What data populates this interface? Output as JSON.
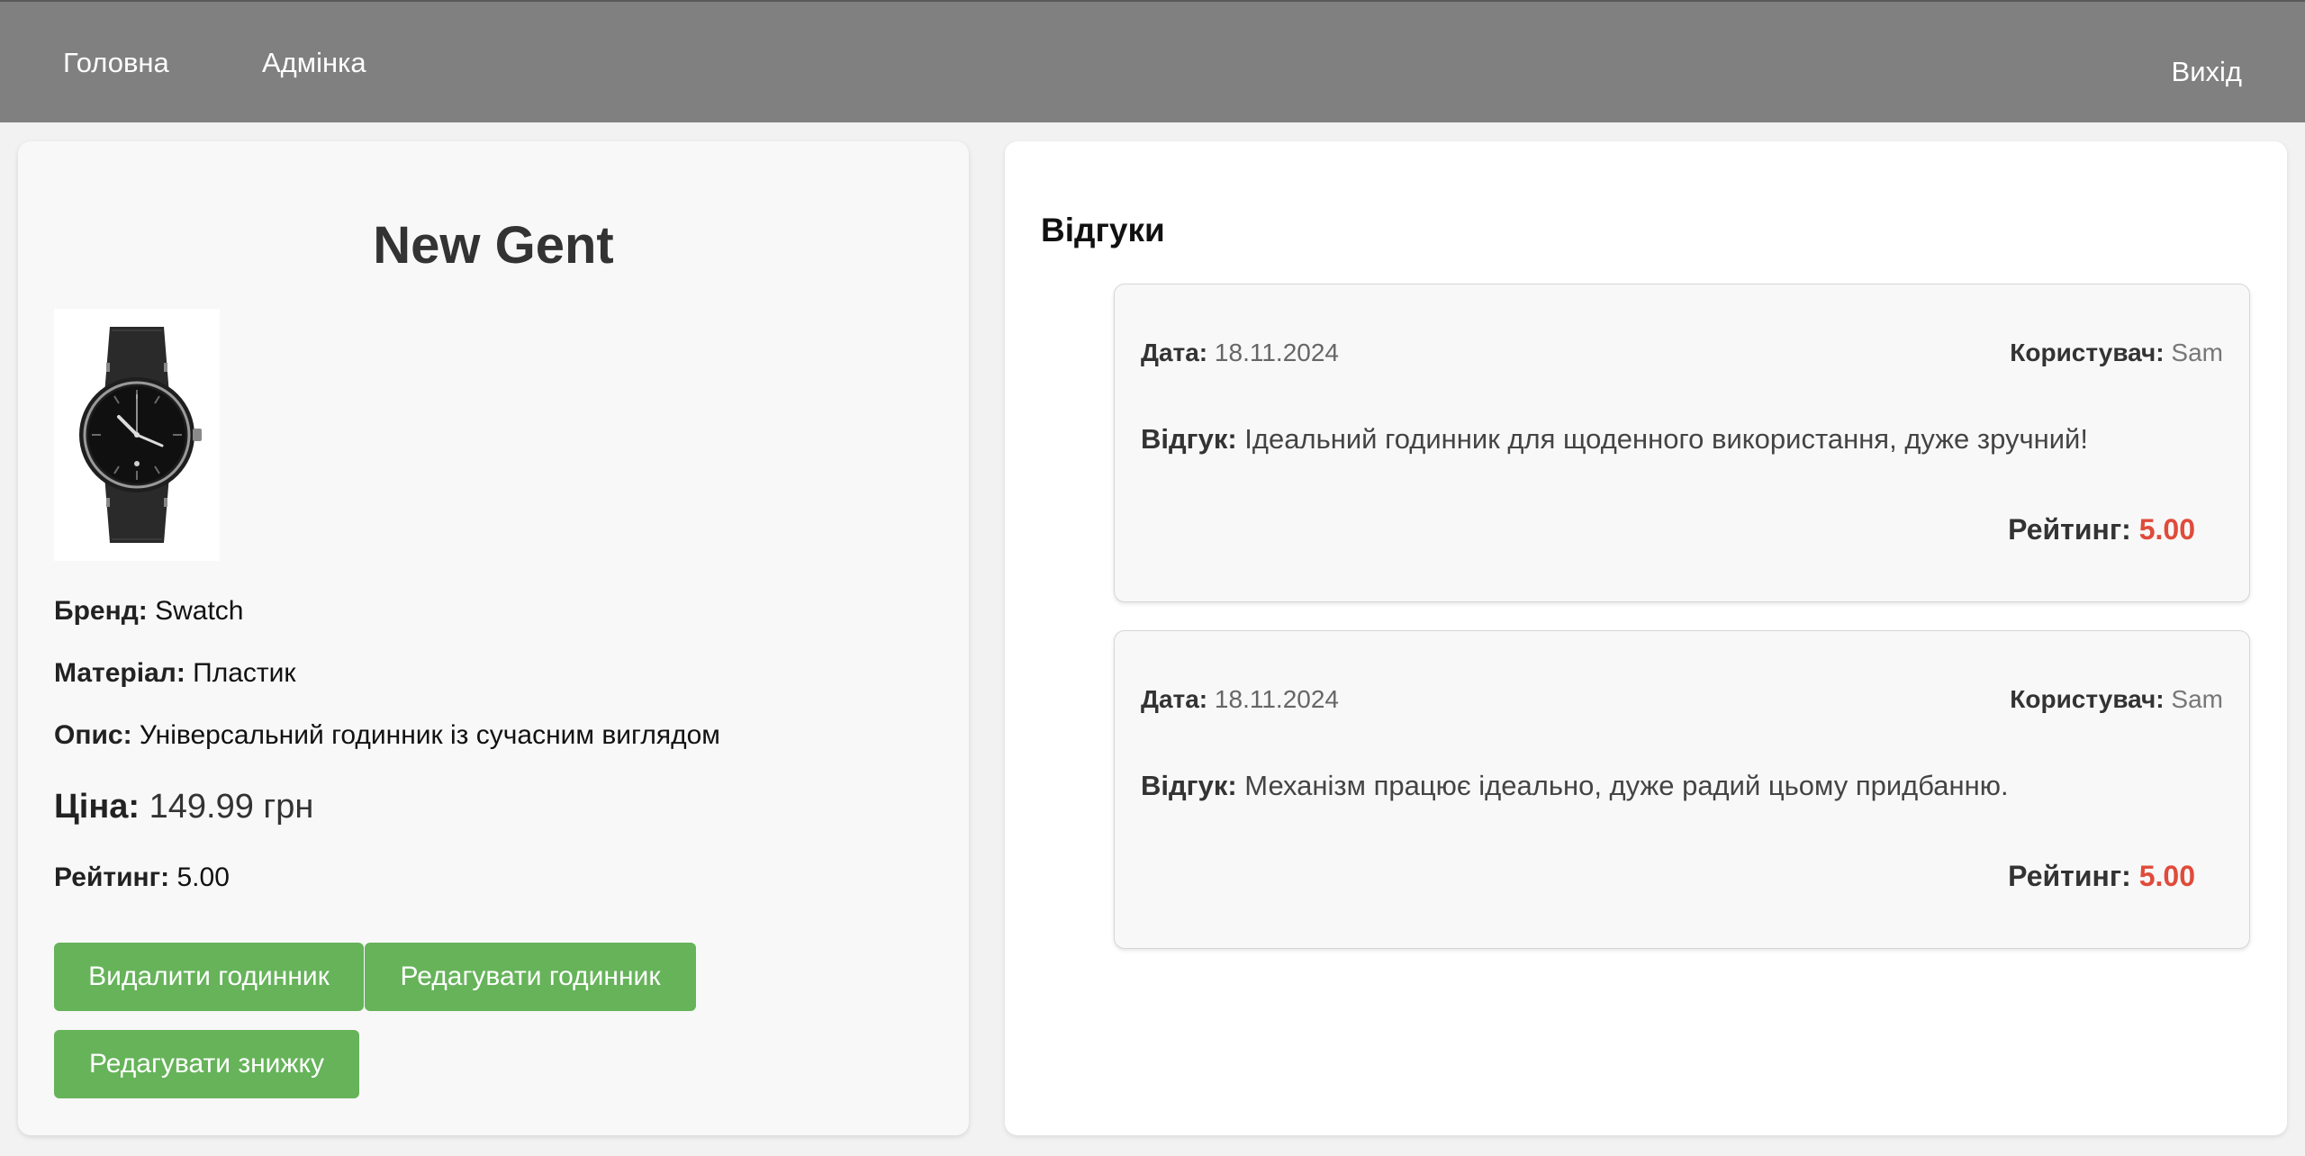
{
  "nav": {
    "home": "Головна",
    "admin": "Адмінка",
    "logout": "Вихід"
  },
  "product": {
    "title": "New Gent",
    "brand_label": "Бренд:",
    "brand": "Swatch",
    "material_label": "Матеріал:",
    "material": "Пластик",
    "description_label": "Опис:",
    "description": "Універсальний годинник із сучасним виглядом",
    "price_label": "Ціна:",
    "price": "149.99 грн",
    "rating_label": "Рейтинг:",
    "rating": "5.00",
    "buttons": {
      "delete": "Видалити годинник",
      "edit": "Редагувати годинник",
      "discount": "Редагувати знижку"
    },
    "image_icon": "wristwatch-image"
  },
  "reviews": {
    "title": "Відгуки",
    "items": [
      {
        "date_label": "Дата:",
        "date": "18.11.2024",
        "user_label": "Користувач:",
        "user": "Sam",
        "text_label": "Відгук:",
        "text": "Ідеальний годинник для щоденного використання, дуже зручний!",
        "rating_label": "Рейтинг:",
        "rating": "5.00"
      },
      {
        "date_label": "Дата:",
        "date": "18.11.2024",
        "user_label": "Користувач:",
        "user": "Sam",
        "text_label": "Відгук:",
        "text": "Механізм працює ідеально, дуже радий цьому придбанню.",
        "rating_label": "Рейтинг:",
        "rating": "5.00"
      }
    ]
  },
  "colors": {
    "navbar": "#808080",
    "button": "#66b35a",
    "rating_accent": "#e04b3a"
  }
}
